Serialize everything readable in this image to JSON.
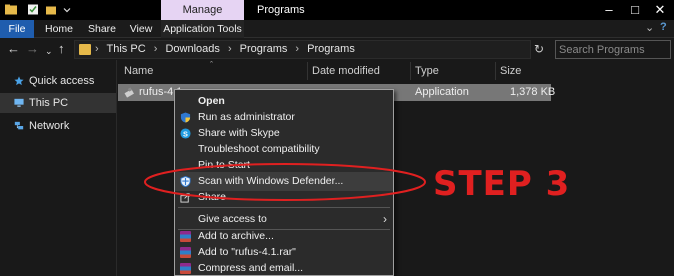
{
  "window": {
    "title": "Programs",
    "context_tab": "Manage"
  },
  "ribbon": {
    "tabs": [
      "File",
      "Home",
      "Share",
      "View",
      "Application Tools"
    ]
  },
  "address": {
    "crumbs": [
      "This PC",
      "Downloads",
      "Programs",
      "Programs"
    ],
    "search_placeholder": "Search Programs"
  },
  "sidebar": {
    "items": [
      {
        "label": "Quick access",
        "icon": "star-icon"
      },
      {
        "label": "This PC",
        "icon": "computer-icon",
        "selected": true
      },
      {
        "label": "Network",
        "icon": "network-icon"
      }
    ]
  },
  "filelist": {
    "columns": [
      "Name",
      "Date modified",
      "Type",
      "Size"
    ],
    "rows": [
      {
        "name": "rufus-4.1",
        "date": "",
        "type": "Application",
        "size": "1,378 KB"
      }
    ]
  },
  "context_menu": {
    "items": [
      {
        "label": "Open",
        "bold": true
      },
      {
        "label": "Run as administrator",
        "icon": "uac-shield-icon"
      },
      {
        "label": "Share with Skype",
        "icon": "skype-icon"
      },
      {
        "label": "Troubleshoot compatibility"
      },
      {
        "label": "Pin to Start"
      },
      {
        "label": "Scan with Windows Defender...",
        "icon": "defender-shield-icon",
        "highlighted": true
      },
      {
        "label": "Share",
        "icon": "share-icon"
      },
      {
        "label": "Give access to",
        "submenu": true
      },
      {
        "label": "Add to archive...",
        "icon": "winrar-icon"
      },
      {
        "label": "Add to \"rufus-4.1.rar\"",
        "icon": "winrar-icon"
      },
      {
        "label": "Compress and email...",
        "icon": "winrar-icon"
      }
    ]
  },
  "annotation": {
    "text": "STEP 3",
    "color": "#e02020"
  },
  "colors": {
    "accent_file_tab": "#1f5dae",
    "manage_tab": "#e6d4f3"
  }
}
